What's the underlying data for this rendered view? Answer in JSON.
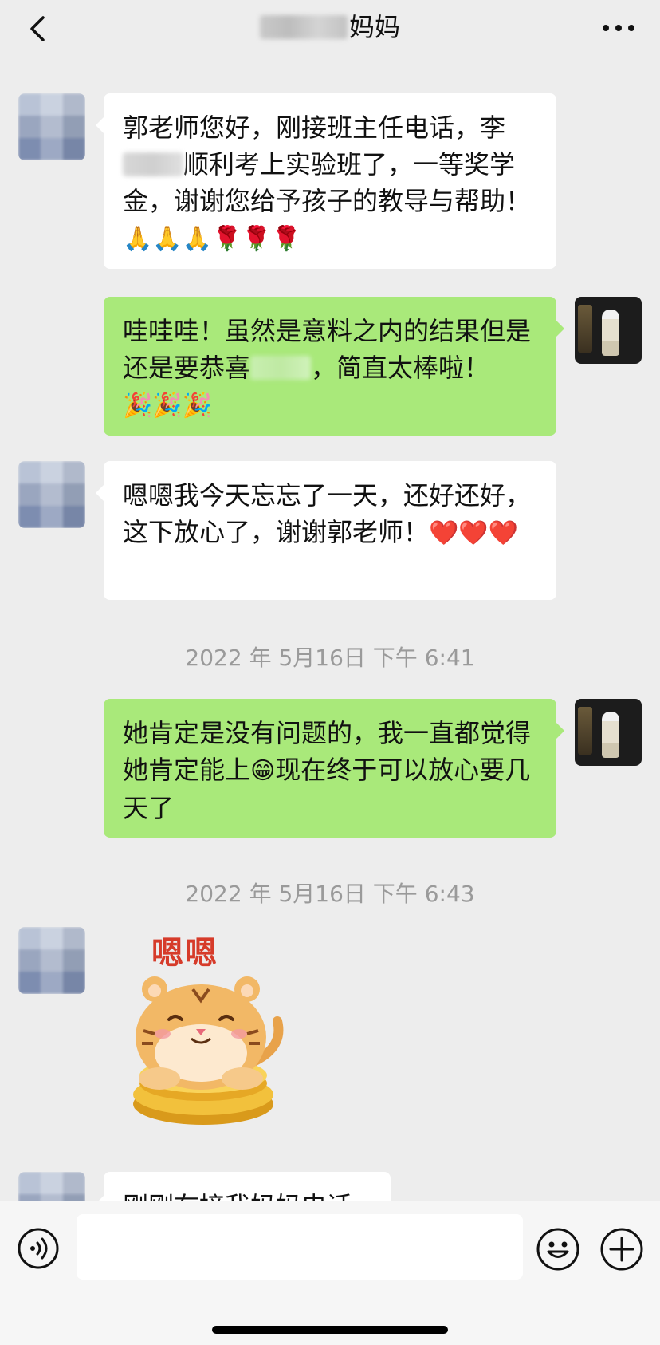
{
  "header": {
    "title_suffix": "妈妈",
    "back_icon": "chevron-left-icon",
    "more_icon": "ellipsis-icon"
  },
  "messages": [
    {
      "side": "left",
      "text_a": "郭老师您好，刚接班主任电话，李",
      "text_b": "顺利考上实验班了，一等奖学金，谢谢您给予孩子的教导与帮助！",
      "emoji": "🙏🙏🙏🌹🌹🌹"
    },
    {
      "side": "right",
      "text_a": "哇哇哇！虽然是意料之内的结果但是还是要恭喜",
      "text_b": "，简直太棒啦！",
      "emoji": "🎉🎉🎉"
    },
    {
      "side": "left",
      "text": "嗯嗯我今天忘忘了一天，还好还好，这下放心了，谢谢郭老师！",
      "emoji": "❤️❤️❤️"
    },
    {
      "side": "right",
      "text_a": "她肯定是没有问题的，我一直都觉得她肯定能上",
      "emoji": "😁",
      "text_b": "现在终于可以放心要几天了"
    },
    {
      "side": "left",
      "sticker_text": "嗯嗯"
    },
    {
      "side": "left",
      "text": "刚刚在接我妈妈电话"
    }
  ],
  "timestamps": [
    "2022 年 5月16日 下午 6:41",
    "2022 年 5月16日 下午 6:43"
  ],
  "bottom_bar": {
    "voice_icon": "voice-icon",
    "emoji_icon": "smiley-icon",
    "plus_icon": "plus-circle-icon",
    "input_value": ""
  }
}
